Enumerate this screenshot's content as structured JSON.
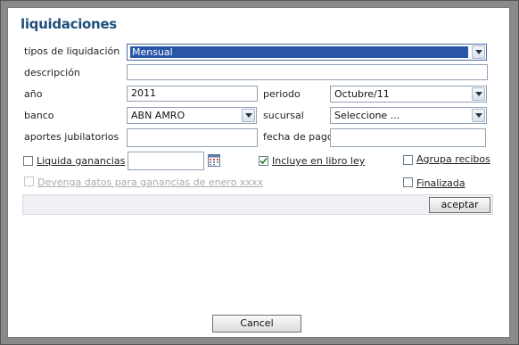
{
  "dialog": {
    "title": "liquidaciones"
  },
  "form": {
    "tipos_label": "tipos de liquidación",
    "tipos_value": "Mensual",
    "descripcion_label": "descripción",
    "descripcion_value": "",
    "anio_label": "año",
    "anio_value": "2011",
    "periodo_label": "periodo",
    "periodo_value": "Octubre/11",
    "banco_label": "banco",
    "banco_value": "ABN AMRO",
    "sucursal_label": "sucursal",
    "sucursal_value": "Seleccione ...",
    "aportes_label": "aportes jubilatorios",
    "aportes_value": "",
    "fecha_label": "fecha de pago",
    "fecha_value": "",
    "liquida_label": "Liquida ganancias",
    "liquida_date_value": "",
    "incluye_label": "Incluye en libro ley",
    "agrupa_label": "Agrupa recibos",
    "devenga_label": "Devenga datos para ganancias de enero xxxx",
    "finalizada_label": "Finalizada"
  },
  "buttons": {
    "aceptar": "aceptar",
    "cancel": "Cancel"
  },
  "icons": {
    "dropdown": "chevron-down-icon",
    "calendar": "calendar-icon",
    "check": "check-icon"
  },
  "colors": {
    "title": "#1f4e79",
    "selection": "#2a56a8"
  }
}
